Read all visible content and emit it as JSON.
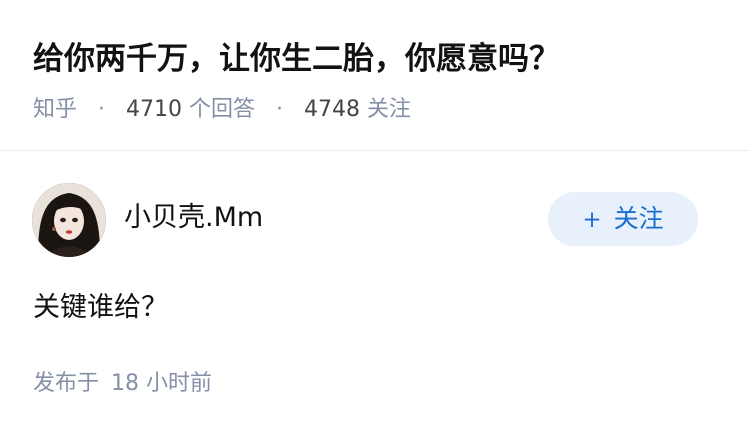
{
  "question": {
    "title": "给你两千万，让你生二胎，你愿意吗？",
    "source": "知乎",
    "answers_count": "4710",
    "answers_suffix": "个回答",
    "followers_count": "4748",
    "followers_suffix": "关注",
    "separator": "·"
  },
  "answer": {
    "author": {
      "name": "小贝壳.Mm",
      "avatar_icon": "avatar-portrait"
    },
    "follow_button": {
      "plus": "+",
      "label": "关注"
    },
    "content": "关键谁给？",
    "time_prefix": "发布于",
    "time_value": "18 小时前"
  },
  "colors": {
    "text": "#121212",
    "muted": "#8590a6",
    "follow_bg": "#e8f1fb",
    "follow_text": "#1a6fce"
  }
}
